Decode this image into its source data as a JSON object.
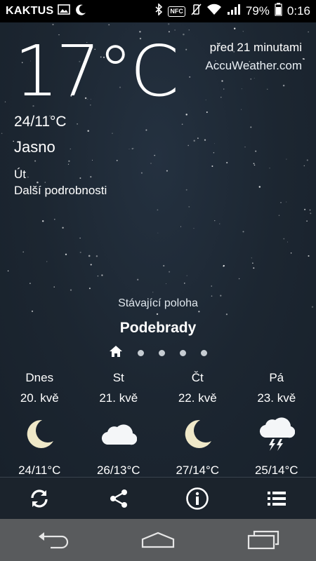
{
  "status_bar": {
    "carrier": "KAKTUS",
    "battery": "79%",
    "time": "0:16",
    "icons": [
      "image-icon",
      "moon-icon",
      "bluetooth-icon",
      "nfc-icon",
      "vibrate-icon",
      "wifi-icon",
      "signal-icon",
      "battery-icon"
    ],
    "nfc_label": "NFC"
  },
  "current": {
    "temperature": "17°C",
    "updated": "před 21 minutami",
    "provider": "AccuWeather.com",
    "hi_lo": "24/11°C",
    "condition": "Jasno",
    "day": "Út",
    "details_link": "Další podrobnosti"
  },
  "location": {
    "label": "Stávající poloha",
    "name": "Podebrady",
    "pages_total": 5,
    "current_page": 1
  },
  "forecast": [
    {
      "day": "Dnes",
      "date": "20. kvě",
      "icon": "moon-icon",
      "temps": "24/11°C"
    },
    {
      "day": "St",
      "date": "21. kvě",
      "icon": "cloud-icon",
      "temps": "26/13°C"
    },
    {
      "day": "Čt",
      "date": "22. kvě",
      "icon": "moon-icon",
      "temps": "27/14°C"
    },
    {
      "day": "Pá",
      "date": "23. kvě",
      "icon": "thunderstorm-icon",
      "temps": "25/14°C"
    }
  ],
  "toolbar": {
    "icons": [
      "refresh-icon",
      "share-icon",
      "info-icon",
      "list-icon"
    ]
  },
  "navbar": {
    "icons": [
      "back-icon",
      "home-icon",
      "recents-icon"
    ]
  },
  "colors": {
    "background": "#1b2530",
    "moon": "#efe8c8",
    "navbar": "#595b5d"
  }
}
